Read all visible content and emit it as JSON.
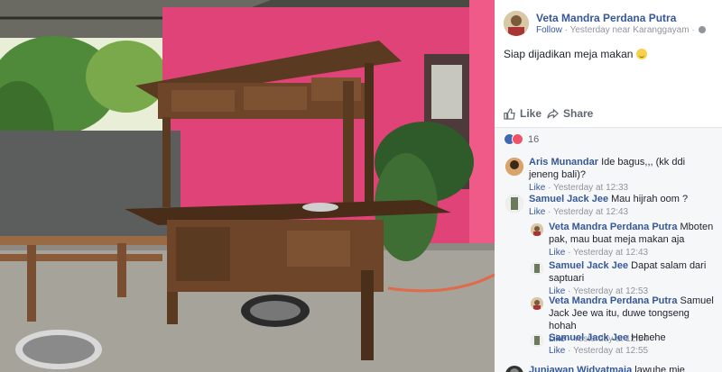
{
  "post": {
    "author": "Veta Mandra Perdana Putra",
    "follow_label": "Follow",
    "meta_text": " · Yesterday near Karanggayam · ",
    "caption": "Siap dijadikan meja makan ",
    "actions": {
      "like_label": "Like",
      "share_label": "Share"
    },
    "reaction_count": "16"
  },
  "comments": [
    {
      "name": "Aris Munandar",
      "text": " Ide bagus,,, (kk ddi jeneng bali)?",
      "like_label": "Like",
      "time": "Yesterday at 12:33"
    },
    {
      "name": "Samuel Jack Jee",
      "text": " Mau hijrah oom ?",
      "like_label": "Like",
      "time": "Yesterday at 12:43"
    },
    {
      "name": "Veta Mandra Perdana Putra",
      "text": " Mboten pak, mau buat meja makan aja",
      "like_label": "Like",
      "time": "Yesterday at 12:43"
    },
    {
      "name": "Samuel Jack Jee",
      "text": " Dapat salam dari saptuari",
      "like_label": "Like",
      "time": "Yesterday at 12:53"
    },
    {
      "name": "Veta Mandra Perdana Putra",
      "text": " Samuel Jack Jee wa itu, duwe tongseng hohah",
      "like_label": "Like",
      "time": "Yesterday at 12:54"
    },
    {
      "name": "Samuel Jack Jee",
      "text": " Hehehe",
      "like_label": "Like",
      "time": "Yesterday at 12:55"
    },
    {
      "name": "Juniawan Widyatmaja",
      "text": " lawuhe mie ayam terus",
      "like_label": "",
      "time": ""
    }
  ],
  "colors": {
    "link_blue": "#365899",
    "wall_pink": "#e04377",
    "wood_brown": "#5b3a22"
  },
  "icons": {
    "like": "thumbs-up-icon",
    "share": "share-arrow-icon",
    "audience": "globe-icon",
    "emoji": "smile-emoji-icon"
  }
}
